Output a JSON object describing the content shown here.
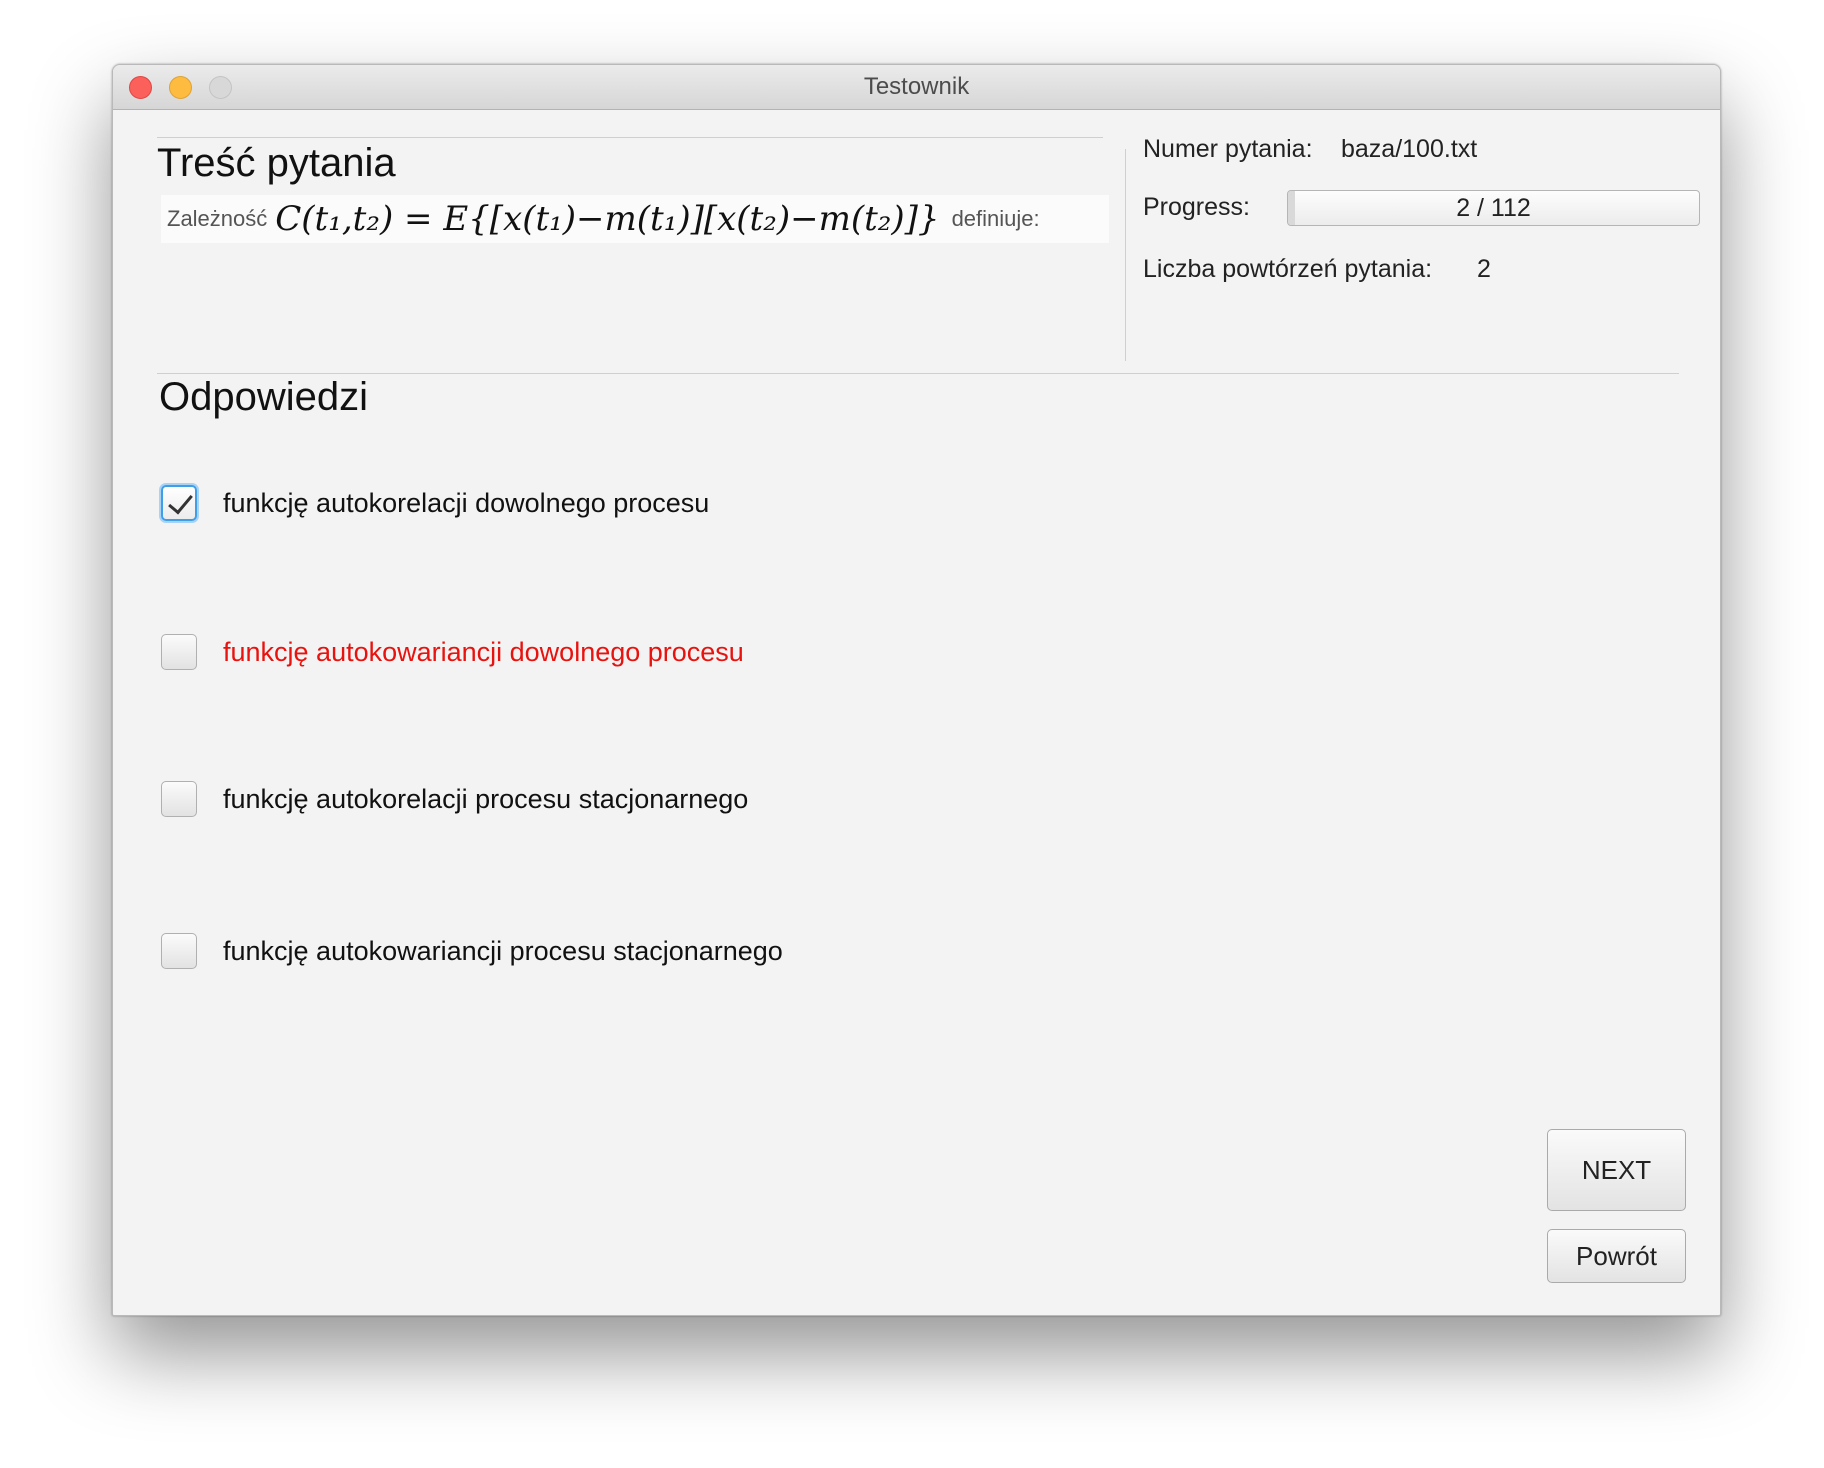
{
  "window": {
    "title": "Testownik"
  },
  "question": {
    "heading": "Treść pytania",
    "text_before": "Zależność",
    "formula": "C(t₁,t₂) = E{[x(t₁)−m(t₁)][x(t₂)−m(t₂)]}",
    "text_after": "definiuje:"
  },
  "info": {
    "number_label": "Numer pytania:",
    "number_value": "baza/100.txt",
    "progress_label": "Progress:",
    "progress_text": "2 / 112",
    "progress_current": 2,
    "progress_total": 112,
    "repeats_label": "Liczba powtórzeń pytania:",
    "repeats_value": "2"
  },
  "answers": {
    "heading": "Odpowiedzi",
    "items": [
      {
        "label": "funkcję autokorelacji dowolnego procesu",
        "checked": true,
        "marked_wrong": false
      },
      {
        "label": "funkcję autokowariancji dowolnego procesu",
        "checked": false,
        "marked_wrong": true,
        "color": "#e8130f"
      },
      {
        "label": "funkcję autokorelacji procesu stacjonarnego",
        "checked": false,
        "marked_wrong": false
      },
      {
        "label": "funkcję autokowariancji procesu stacjonarnego",
        "checked": false,
        "marked_wrong": false
      }
    ]
  },
  "buttons": {
    "next": "NEXT",
    "back": "Powrót"
  }
}
